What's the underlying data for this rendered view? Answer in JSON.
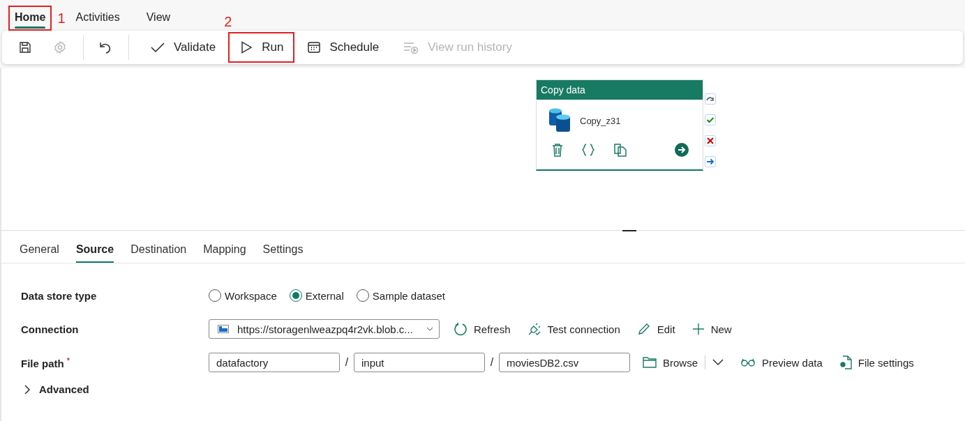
{
  "menu_tabs": [
    {
      "label": "Home",
      "selected": true,
      "annotation": "1"
    },
    {
      "label": "Activities",
      "selected": false
    },
    {
      "label": "View",
      "selected": false
    }
  ],
  "toolbar": [
    {
      "kind": "icon_button",
      "disabled": false
    },
    {
      "kind": "icon_button",
      "disabled": true
    },
    {
      "kind": "divider"
    },
    {
      "kind": "icon_button",
      "disabled": false
    },
    {
      "kind": "divider"
    },
    {
      "kind": "button",
      "label": "Validate",
      "disabled": false
    },
    {
      "kind": "button",
      "label": "Run",
      "disabled": false,
      "annotation": "2"
    },
    {
      "kind": "button",
      "label": "Schedule",
      "disabled": false
    },
    {
      "kind": "button",
      "label": "View run history",
      "disabled": true
    }
  ],
  "activity": {
    "title": "Copy data",
    "name": "Copy_z31"
  },
  "panel_tabs": [
    {
      "label": "General",
      "selected": false
    },
    {
      "label": "Source",
      "selected": true
    },
    {
      "label": "Destination",
      "selected": false
    },
    {
      "label": "Mapping",
      "selected": false
    },
    {
      "label": "Settings",
      "selected": false
    }
  ],
  "form": {
    "data_store_type": {
      "label": "Data store type",
      "options": [
        {
          "label": "Workspace",
          "selected": false
        },
        {
          "label": "External",
          "selected": true
        },
        {
          "label": "Sample dataset",
          "selected": false
        }
      ]
    },
    "connection": {
      "label": "Connection",
      "value": "https://storagenlweazpq4r2vk.blob.c...",
      "actions": [
        {
          "label": "Refresh"
        },
        {
          "label": "Test connection"
        },
        {
          "label": "Edit"
        },
        {
          "label": "New"
        }
      ]
    },
    "file_path": {
      "label": "File path",
      "required_mark": "*",
      "segments": [
        "datafactory",
        "input",
        "moviesDB2.csv"
      ],
      "separators": [
        "/",
        "/"
      ],
      "actions": [
        {
          "label": "Browse",
          "menu": true
        },
        {
          "label": "Preview data"
        },
        {
          "label": "File settings"
        }
      ]
    },
    "advanced": {
      "label": "Advanced",
      "expanded": false
    }
  }
}
